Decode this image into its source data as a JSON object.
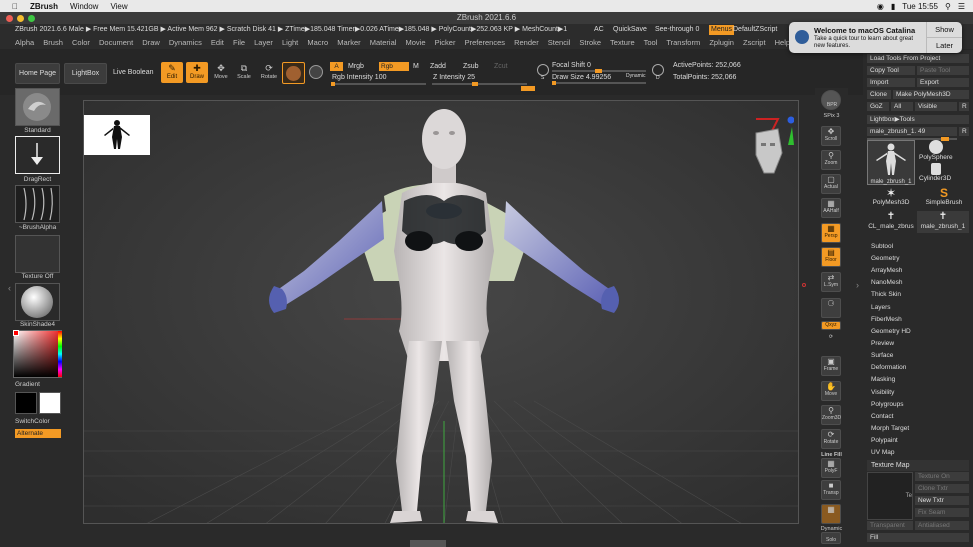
{
  "mac_menubar": {
    "app": "ZBrush",
    "window": "Window",
    "view": "View",
    "time": "Tue 15:55"
  },
  "title": "ZBrush 2021.6.6",
  "info": "ZBrush 2021.6.6 Male  ▶ Free Mem 15.421GB ▶ Active Mem 962 ▶ Scratch Disk 41 ▶ ZTime▶185.048 Timer▶0.026 ATime▶185.048 ▶ PolyCount▶252.063 KP ▶ MeshCount▶1",
  "info_right": {
    "ac": "AC",
    "quicksave": "QuickSave",
    "seethrough": "See-through  0",
    "menus": "Menus",
    "script": "DefaultZScript"
  },
  "menus": [
    "Alpha",
    "Brush",
    "Color",
    "Document",
    "Draw",
    "Dynamics",
    "Edit",
    "File",
    "Layer",
    "Light",
    "Macro",
    "Marker",
    "Material",
    "Movie",
    "Picker",
    "Preferences",
    "Render",
    "Stencil",
    "Stroke",
    "Texture",
    "Tool",
    "Transform",
    "Zplugin",
    "Zscript",
    "Help"
  ],
  "shelf": {
    "home": "Home Page",
    "lightbox": "LightBox",
    "live_boolean": "Live Boolean",
    "edit": "Edit",
    "draw": "Draw",
    "move": "Move",
    "scale": "Scale",
    "rotate": "Rotate",
    "a": "A",
    "mrgb": "Mrgb",
    "rgb": "Rgb",
    "m": "M",
    "zadd": "Zadd",
    "zsub": "Zsub",
    "zcut": "Zcut",
    "rgb_intensity": "Rgb Intensity 100",
    "z_intensity": "Z Intensity 25",
    "focal_shift": "Focal Shift 0",
    "draw_size": "Draw Size 4.99256",
    "dynamic": "Dynamic",
    "active_points": "ActivePoints: 252,066",
    "total_points": "TotalPoints: 252,066"
  },
  "left": {
    "standard": "Standard",
    "dragrect": "DragRect",
    "brushalpha": "~BrushAlpha",
    "texture_off": "Texture Off",
    "skinshade": "SkinShade4",
    "gradient": "Gradient",
    "switchcolor": "SwitchColor",
    "alternate": "Alternate"
  },
  "right_tools": {
    "bpr": "BPR",
    "spix": "SPix 3",
    "scroll": "Scroll",
    "zoom": "Zoom",
    "actual": "Actual",
    "aahalf": "AAHalf",
    "persp": "Persp",
    "floor": "Floor",
    "lsym": "L.Sym",
    "gxyz": "Qxyz",
    "frame": "Frame",
    "move": "Move",
    "zoom3d": "Zoom3D",
    "rotate": "Rotate",
    "linefill": "Line Fill",
    "polyf": "PolyF",
    "transp": "Transp",
    "dynamic": "Dynamic",
    "solo": "Solo"
  },
  "tool_panel": {
    "load_tools": "Load Tools From Project",
    "copy_tool": "Copy Tool",
    "paste_tool": "Paste Tool",
    "import": "Import",
    "export": "Export",
    "clone": "Clone",
    "make_polymesh": "Make PolyMesh3D",
    "goz": "GoZ",
    "all": "All",
    "visible": "Visible",
    "r": "R",
    "lightbox_tools": "Lightbox▶Tools",
    "tool_name": "male_zbrush_1.  49",
    "r2": "R",
    "tools": [
      "male_zbrush_1",
      "PolySphere",
      "Cylinder3D",
      "PolyMesh3D",
      "SimpleBrush",
      "CL_male_zbrus",
      "male_zbrush_1"
    ],
    "subpalettes": [
      "Subtool",
      "Geometry",
      "ArrayMesh",
      "NanoMesh",
      "Thick Skin",
      "Layers",
      "FiberMesh",
      "Geometry HD",
      "Preview",
      "Surface",
      "Deformation",
      "Masking",
      "Visibility",
      "Polygroups",
      "Contact",
      "Morph Target",
      "Polypaint",
      "UV Map"
    ],
    "texture_map": "Texture Map",
    "texture_on": "Texture On",
    "clone_txtr": "Clone Txtr",
    "new_txtr": "New Txtr",
    "fix_seam": "Fix Seam",
    "transparent": "Transparent",
    "antialiased": "Antialiased",
    "fill": "Fill",
    "te": "Te"
  },
  "notification": {
    "title": "Welcome to macOS Catalina",
    "body": "Take a quick tour to learn about great new features.",
    "show": "Show",
    "later": "Later"
  },
  "colors": {
    "accent": "#f39a24",
    "bg": "#2a2a2a",
    "canvas": "#393939"
  }
}
